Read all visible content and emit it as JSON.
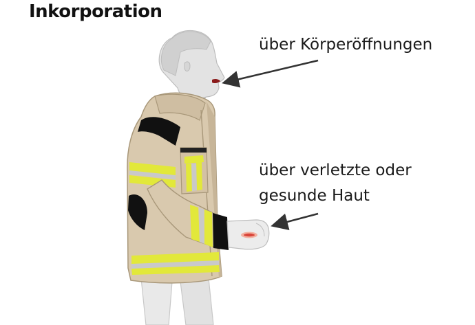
{
  "title": "Inkorporation",
  "labels": {
    "mouth": "über Körperöffnungen",
    "skin_line1": "über verletzte oder",
    "skin_line2": "gesunde Haut"
  },
  "colors": {
    "jacket": "#d9c9ae",
    "jacket_shadow": "#c7b598",
    "reflective_yellow": "#e2e83a",
    "reflective_silver": "#c9c9c9",
    "skin_grey": "#e3e3e3",
    "wound": "#d9453a",
    "arrow": "#333333"
  }
}
